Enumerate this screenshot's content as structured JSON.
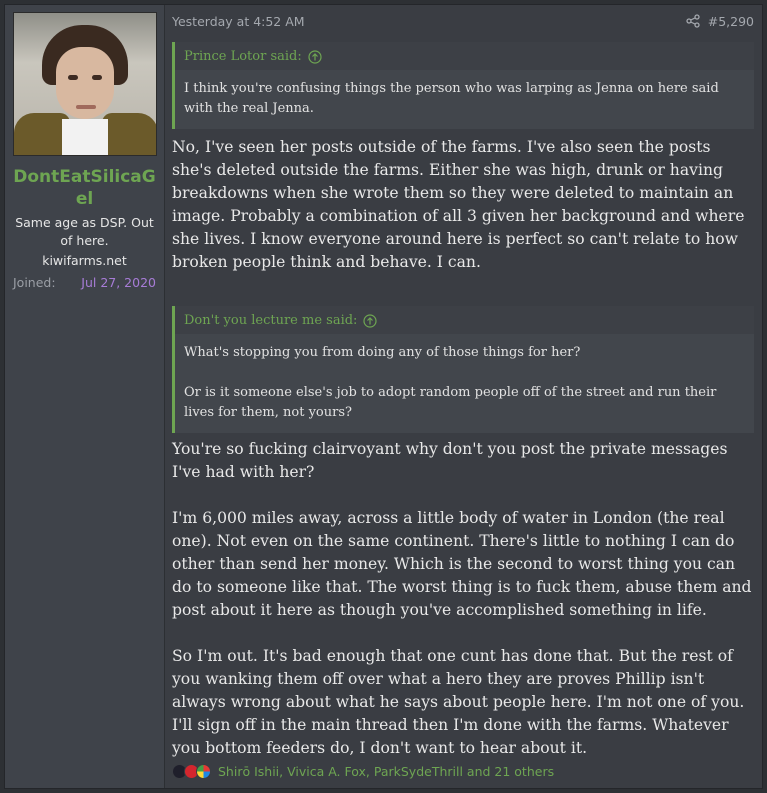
{
  "user": {
    "name": "DontEatSilicaGel",
    "title": "Same age as DSP. Out of here.",
    "site": "kiwifarms.net",
    "joined_label": "Joined:",
    "joined_date": "Jul 27, 2020"
  },
  "post": {
    "timestamp": "Yesterday at 4:52 AM",
    "number": "#5,290",
    "quotes": [
      {
        "author": "Prince Lotor said:",
        "paragraphs": [
          "I think you're confusing things the person who was larping as Jenna on here said with the real Jenna."
        ]
      },
      {
        "author": "Don't you lecture me said:",
        "paragraphs": [
          "What's stopping you from doing any of those things for her?",
          "Or is it someone else's job to adopt random people off of the street and run their lives for them, not yours?"
        ]
      }
    ],
    "reply1": "No, I've seen her posts outside of the farms. I've also seen the posts she's deleted outside the farms. Either she was high, drunk or having breakdowns when she wrote them so they were deleted to maintain an image. Probably a combination of all 3 given her background and where she lives. I know everyone around here is perfect so can't relate to how broken people think and behave. I can.",
    "reply2": [
      "You're so fucking clairvoyant why don't you post the private messages I've had with her?",
      "I'm 6,000 miles away, across a little body of water in London (the real one). Not even on the same continent. There's little to nothing I can do other than send her money. Which is the second to worst thing you can do to someone like that. The worst thing is to fuck them, abuse them and post about it here as though you've accomplished something in life.",
      "So I'm out. It's bad enough that one cunt has done that. But the rest of you wanking them off over what a hero they are proves Phillip isn't always wrong about what he says about people here. I'm not one of you. I'll sign off in the main thread then I'm done with the farms. Whatever you bottom feeders do, I don't want to hear about it."
    ],
    "reactions": "Shirō Ishii, Vivica A. Fox, ParkSydeThrill and 21 others"
  },
  "icons": {
    "share": "share-icon",
    "quote_jump": "arrow-up-circle-icon",
    "reactions": [
      "tophat-icon",
      "heart-icon",
      "puzzle-icon"
    ]
  },
  "colors": {
    "accent": "#6ea552",
    "joined_date": "#a77cd6"
  }
}
